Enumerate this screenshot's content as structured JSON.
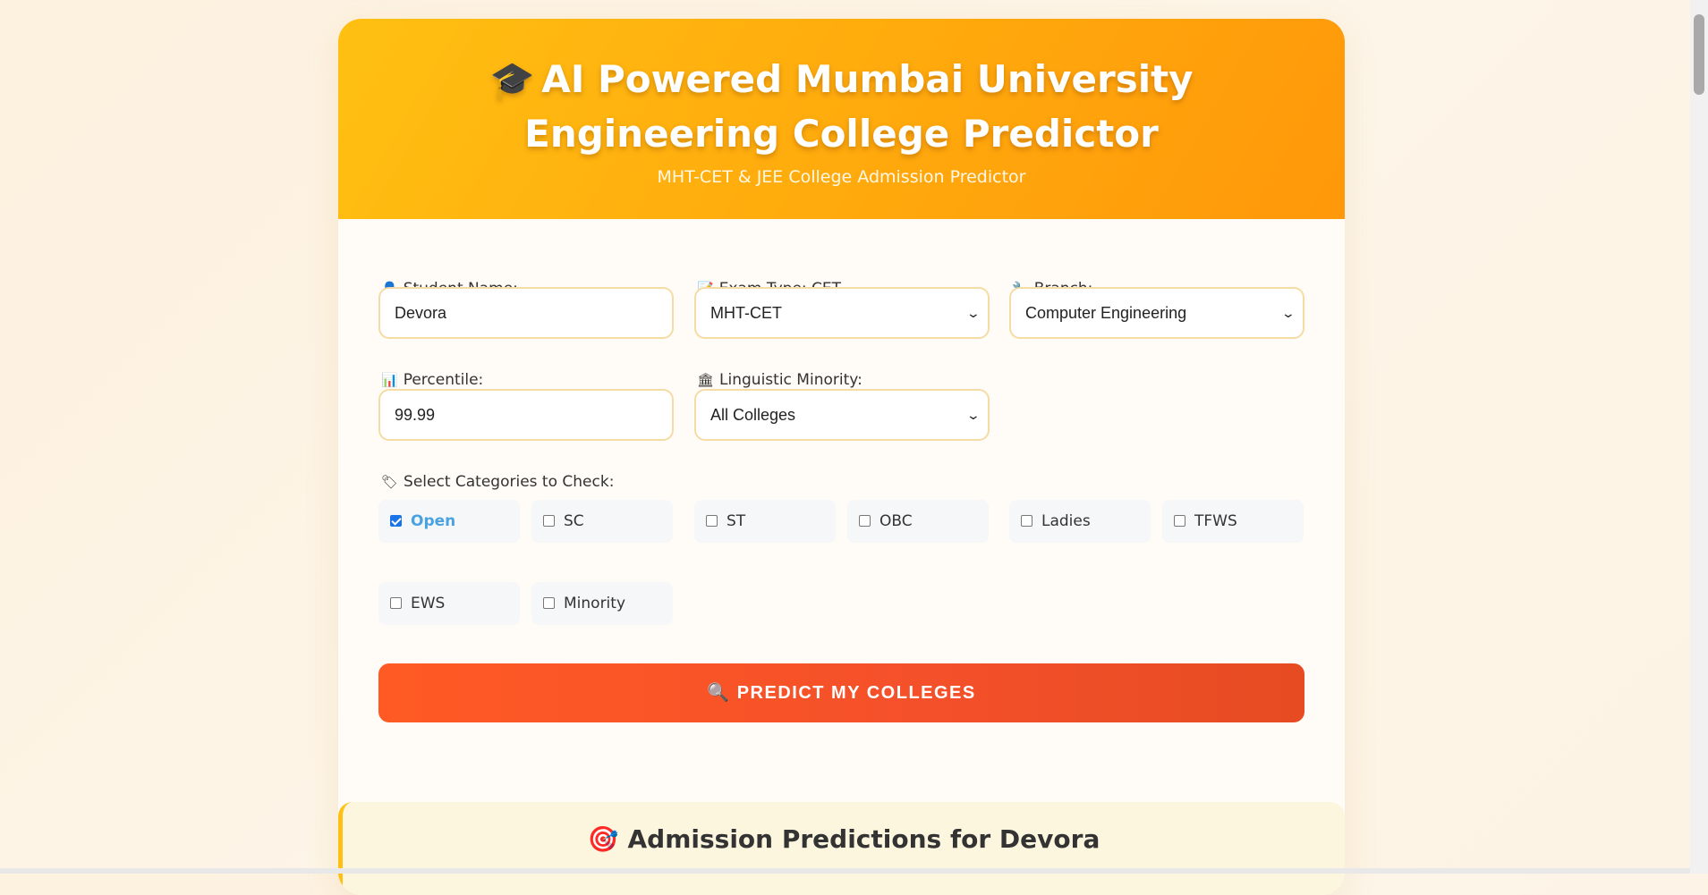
{
  "header": {
    "icon": "graduation-cap-icon",
    "title": "AI Powered Mumbai University Engineering College Predictor",
    "subtitle": "MHT-CET & JEE College Admission Predictor"
  },
  "form": {
    "student_name": {
      "icon": "person-icon",
      "label": "Student Name:",
      "value": "Devora"
    },
    "exam_type": {
      "icon": "memo-icon",
      "label": "Exam Type: CET",
      "value": "MHT-CET"
    },
    "branch": {
      "icon": "wrench-icon",
      "label": "Branch:",
      "value": "Computer Engineering"
    },
    "percentile": {
      "icon": "bar-chart-icon",
      "label": "Percentile:",
      "value": "99.99"
    },
    "minority": {
      "icon": "bank-icon",
      "label": "Linguistic Minority:",
      "value": "All Colleges"
    },
    "categories_label": "Select Categories to Check:",
    "categories_icon": "tag-icon",
    "categories": [
      {
        "label": "Open",
        "checked": true
      },
      {
        "label": "SC",
        "checked": false
      },
      {
        "label": "ST",
        "checked": false
      },
      {
        "label": "OBC",
        "checked": false
      },
      {
        "label": "Ladies",
        "checked": false
      },
      {
        "label": "TFWS",
        "checked": false
      },
      {
        "label": "EWS",
        "checked": false
      },
      {
        "label": "Minority",
        "checked": false
      }
    ],
    "predict_button": "🔍 PREDICT MY COLLEGES"
  },
  "results": {
    "icon": "target-icon",
    "title": "Admission Predictions for Devora"
  }
}
